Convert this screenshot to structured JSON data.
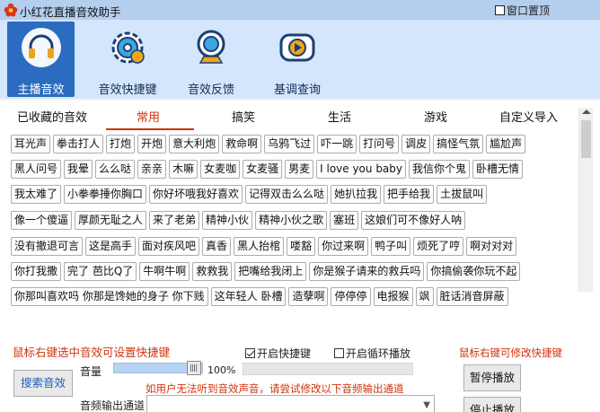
{
  "titlebar": {
    "title": "小红花直播音效助手",
    "pin_label": "窗口置顶"
  },
  "toolbar": [
    {
      "label": "主播音效",
      "icon": "headphones-icon",
      "active": true
    },
    {
      "label": "音效快捷键",
      "icon": "gear-icon",
      "active": false
    },
    {
      "label": "音效反馈",
      "icon": "webcam-icon",
      "active": false
    },
    {
      "label": "基调查询",
      "icon": "play-icon",
      "active": false
    }
  ],
  "tabs": [
    {
      "label": "已收藏的音效",
      "active": false
    },
    {
      "label": "常用",
      "active": true
    },
    {
      "label": "搞笑",
      "active": false
    },
    {
      "label": "生活",
      "active": false
    },
    {
      "label": "游戏",
      "active": false
    },
    {
      "label": "自定义导入",
      "active": false
    }
  ],
  "sound_rows": [
    [
      "耳光声",
      "拳击打人",
      "打炮",
      "开炮",
      "意大利炮",
      "救命啊",
      "乌鸦飞过",
      "吓一跳",
      "打问号",
      "调皮",
      "搞怪气氛",
      "尴尬声"
    ],
    [
      "黑人问号",
      "我晕",
      "么么哒",
      "亲亲",
      "木嘛",
      "女麦咖",
      "女麦骚",
      "男麦",
      "I love you baby",
      "我信你个鬼",
      "卧槽无情"
    ],
    [
      "我太难了",
      "小拳拳捶你胸口",
      "你好坏哦我好喜欢",
      "记得双击么么哒",
      "她扒拉我",
      "把手给我",
      "土拔鼠叫"
    ],
    [
      "像一个傻逼",
      "厚颜无耻之人",
      "来了老弟",
      "精神小伙",
      "精神小伙之歌",
      "塞班",
      "这娘们可不像好人呐"
    ],
    [
      "没有撤退可言",
      "这是高手",
      "面对疾风吧",
      "真香",
      "黑人抬棺",
      "喽豁",
      "你过来啊",
      "鸭子叫",
      "烦死了哼",
      "啊对对对"
    ],
    [
      "你打我撒",
      "完了 芭比Q了",
      "牛啊牛啊",
      "救救我",
      "把嘴给我闭上",
      "你是猴子请来的救兵吗",
      "你搞偷袭你玩不起"
    ],
    [
      "你那叫喜欢吗 你那是馋她的身子 你下贱",
      "这年轻人 卧槽",
      "造孽啊",
      "停停停",
      "电报猴",
      "飒",
      "脏话消音屏蔽"
    ]
  ],
  "controls": {
    "hint_left": "鼠标右键选中音效可设置快捷键",
    "hotkey_label": "开启快捷键",
    "hotkey_checked": true,
    "loop_label": "开启循环播放",
    "loop_checked": false,
    "hint_right": "鼠标右键可修改快捷键",
    "volume_label": "音量",
    "volume_value": "100%",
    "volume_fraction": 1.0,
    "search_button": "搜索音效",
    "pause_button": "暂停播放",
    "stop_button": "停止播放",
    "warning": "如用户无法听到音效声音，请尝试修改以下音频输出通道",
    "output_label": "音频输出通道",
    "output_value": ""
  },
  "colors": {
    "accent_red": "#d2320a",
    "toolbar_active": "#2b6cc0",
    "titlebar": "#b4ceee"
  }
}
